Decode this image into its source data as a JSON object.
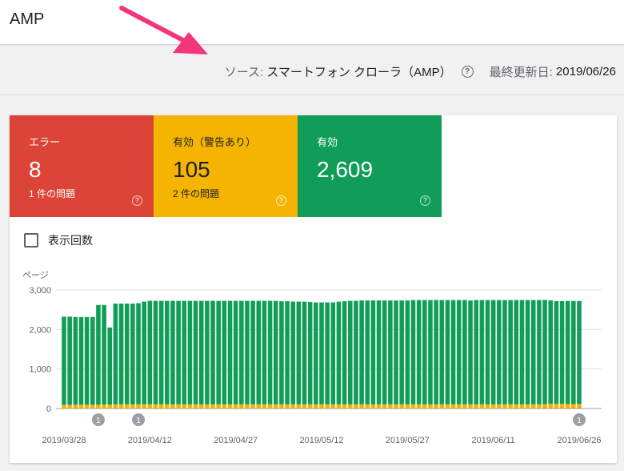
{
  "header": {
    "title": "AMP"
  },
  "info": {
    "source_label": "ソース:",
    "source_value": "スマートフォン クローラ（AMP）",
    "updated_label": "最終更新日:",
    "updated_value": "2019/06/26"
  },
  "tiles": {
    "error": {
      "label": "エラー",
      "value": "8",
      "sub": "1 件の問題",
      "color": "#db4437"
    },
    "warning": {
      "label": "有効（警告あり）",
      "value": "105",
      "sub": "2 件の問題",
      "color": "#f4b400"
    },
    "valid": {
      "label": "有効",
      "value": "2,609",
      "color": "#0f9d58"
    }
  },
  "impressions_checkbox": {
    "label": "表示回数",
    "checked": false
  },
  "chart_data": {
    "type": "bar",
    "stacked": true,
    "ylabel": "ページ",
    "ylim": [
      0,
      3000
    ],
    "yticks": [
      0,
      1000,
      2000,
      3000
    ],
    "ytick_labels": [
      "0",
      "1,000",
      "2,000",
      "3,000"
    ],
    "xtick_labels": [
      "2019/03/28",
      "2019/04/12",
      "2019/04/27",
      "2019/05/12",
      "2019/05/27",
      "2019/06/11",
      "2019/06/26"
    ],
    "xtick_indices": [
      0,
      15,
      30,
      45,
      60,
      75,
      90
    ],
    "date_range": [
      "2019/03/28",
      "2019/06/26"
    ],
    "colors": {
      "valid": "#0f9d58",
      "warning": "#f4b400",
      "error": "#db4437"
    },
    "annotations": [
      {
        "day_index": 6,
        "label": "1"
      },
      {
        "day_index": 13,
        "label": "1"
      },
      {
        "day_index": 90,
        "label": "1"
      }
    ],
    "series": [
      {
        "name": "有効",
        "key": "valid",
        "values": [
          2230,
          2230,
          2220,
          2220,
          2220,
          2220,
          2520,
          2520,
          1950,
          2550,
          2550,
          2550,
          2550,
          2560,
          2600,
          2620,
          2620,
          2620,
          2620,
          2620,
          2620,
          2620,
          2620,
          2620,
          2620,
          2620,
          2620,
          2620,
          2620,
          2620,
          2620,
          2620,
          2620,
          2620,
          2620,
          2620,
          2620,
          2620,
          2610,
          2610,
          2600,
          2600,
          2600,
          2590,
          2580,
          2580,
          2580,
          2580,
          2600,
          2610,
          2620,
          2620,
          2630,
          2630,
          2630,
          2630,
          2630,
          2630,
          2630,
          2630,
          2630,
          2640,
          2640,
          2640,
          2640,
          2640,
          2640,
          2640,
          2640,
          2640,
          2640,
          2630,
          2640,
          2640,
          2640,
          2640,
          2640,
          2640,
          2640,
          2640,
          2640,
          2640,
          2640,
          2640,
          2640,
          2620,
          2600,
          2600,
          2610,
          2610,
          2609
        ]
      },
      {
        "name": "有効（警告あり）",
        "key": "warning",
        "values": [
          90,
          90,
          90,
          90,
          90,
          90,
          95,
          95,
          95,
          100,
          100,
          100,
          100,
          100,
          100,
          100,
          100,
          100,
          100,
          100,
          100,
          100,
          100,
          100,
          100,
          100,
          100,
          100,
          100,
          100,
          100,
          100,
          100,
          100,
          100,
          100,
          100,
          100,
          100,
          100,
          100,
          100,
          100,
          100,
          100,
          100,
          100,
          100,
          100,
          100,
          100,
          100,
          100,
          100,
          100,
          100,
          100,
          100,
          100,
          100,
          100,
          100,
          100,
          100,
          100,
          100,
          100,
          100,
          100,
          100,
          100,
          100,
          100,
          100,
          100,
          100,
          100,
          100,
          100,
          100,
          100,
          100,
          100,
          100,
          100,
          110,
          110,
          110,
          105,
          105,
          105
        ]
      },
      {
        "name": "エラー",
        "key": "error",
        "values": [
          5,
          5,
          5,
          5,
          5,
          5,
          5,
          5,
          5,
          5,
          5,
          5,
          5,
          5,
          5,
          5,
          5,
          5,
          5,
          5,
          5,
          5,
          5,
          5,
          5,
          5,
          5,
          5,
          5,
          5,
          5,
          5,
          5,
          5,
          5,
          5,
          5,
          5,
          5,
          5,
          5,
          5,
          5,
          5,
          5,
          5,
          5,
          5,
          5,
          5,
          5,
          5,
          5,
          5,
          5,
          5,
          5,
          5,
          5,
          5,
          5,
          5,
          5,
          5,
          5,
          5,
          5,
          5,
          5,
          5,
          5,
          5,
          5,
          5,
          5,
          5,
          5,
          5,
          5,
          5,
          5,
          5,
          5,
          5,
          10,
          8,
          8,
          8,
          8,
          8,
          8
        ]
      }
    ]
  }
}
